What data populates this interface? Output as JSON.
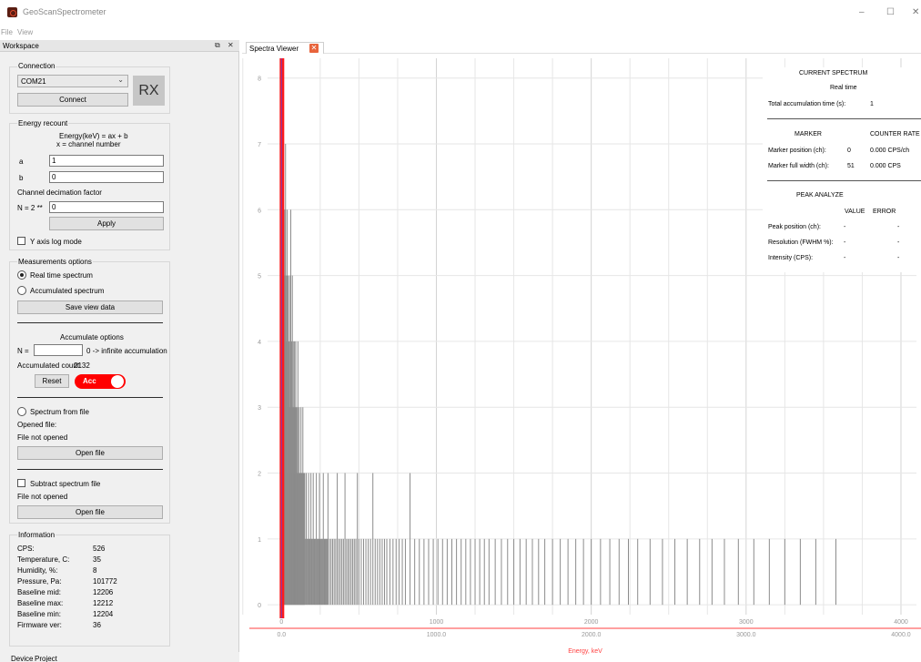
{
  "window": {
    "title": "GeoScanSpectrometer",
    "minimize": "–",
    "maximize": "☐",
    "close": "✕"
  },
  "menu": {
    "file": "File",
    "view": "View"
  },
  "workspace": {
    "title": "Workspace",
    "float_icon": "⧉",
    "close_icon": "✕"
  },
  "connection": {
    "title": "Connection",
    "port": "COM21",
    "connect_label": "Connect",
    "rx_label": "RX"
  },
  "energy": {
    "title": "Energy recount",
    "formula_line1": "Energy(keV) = ax + b",
    "formula_line2": "x = channel number",
    "a_label": "a",
    "a_value": "1",
    "b_label": "b",
    "b_value": "0",
    "decimation_label": "Channel decimation factor",
    "n_label": "N = 2 **",
    "n_value": "0",
    "apply_label": "Apply",
    "log_mode_label": "Y axis log mode"
  },
  "measurements": {
    "title": "Measurements options",
    "realtime_label": "Real time spectrum",
    "accumulated_label": "Accumulated spectrum",
    "save_label": "Save view data",
    "accum_title": "Accumulate options",
    "n_label": "N =",
    "n_value": "",
    "n_hint": "0 -> infinite accumulation",
    "accum_count_label": "Accumulated count:",
    "accum_count_value": "2132",
    "reset_label": "Reset",
    "acc_toggle_label": "Acc",
    "from_file_label": "Spectrum from file",
    "opened_file_label": "Opened file:",
    "file_status": "File not opened",
    "open_file_label": "Open file",
    "subtract_label": "Subtract spectrum file",
    "subtract_status": "File not opened",
    "subtract_open_label": "Open file"
  },
  "information": {
    "title": "Information",
    "rows": [
      {
        "label": "CPS:",
        "value": "526"
      },
      {
        "label": "Temperature, C:",
        "value": "35"
      },
      {
        "label": "Humidity, %:",
        "value": "8"
      },
      {
        "label": "Pressure, Pa:",
        "value": "101772"
      },
      {
        "label": "Baseline mid:",
        "value": "12206"
      },
      {
        "label": "Baseline max:",
        "value": "12212"
      },
      {
        "label": "Baseline min:",
        "value": "12204"
      },
      {
        "label": "Firmware ver:",
        "value": "36"
      }
    ]
  },
  "bottom_tabs": {
    "device": "Device",
    "project": "Project"
  },
  "viewer_tab": {
    "label": "Spectra Viewer",
    "close": "✕"
  },
  "current": {
    "title": "CURRENT SPECTRUM",
    "mode": "Real time",
    "total_label": "Total accumulation time (s):",
    "total_value": "1",
    "marker_header": "MARKER",
    "counter_header": "COUNTER RATE",
    "marker_pos_label": "Marker position (ch):",
    "marker_pos_value": "0",
    "marker_pos_rate": "0.000 CPS/ch",
    "marker_width_label": "Marker full width (ch):",
    "marker_width_value": "51",
    "marker_width_rate": "0.000 CPS",
    "peak_title": "PEAK ANALYZE",
    "value_header": "VALUE",
    "error_header": "ERROR",
    "peak_rows": [
      {
        "label": "Peak position (ch):",
        "value": "-",
        "error": "-"
      },
      {
        "label": "Resolution (FWHM %):",
        "value": "-",
        "error": "-"
      },
      {
        "label": "Intensity (CPS):",
        "value": "-",
        "error": "-"
      }
    ]
  },
  "chart_data": {
    "type": "bar",
    "xlabel": "Energy, keV",
    "ylabel": "",
    "xlim": [
      -90,
      4100
    ],
    "ylim": [
      -0.15,
      8.3
    ],
    "x_ticks_top": [
      "0",
      "1000",
      "2000",
      "3000",
      "4000"
    ],
    "x_ticks_bottom": [
      "0.0",
      "1000.0",
      "2000.0",
      "3000.0",
      "4000.0"
    ],
    "y_ticks": [
      "0",
      "1",
      "2",
      "3",
      "4",
      "5",
      "6",
      "7",
      "8"
    ],
    "grid": true,
    "marker_channel": 0,
    "colors": {
      "bars": "#8c8c8c",
      "marker": "#ff1a1a",
      "marker_inner": "#7b3db8",
      "axis": "#ff4040",
      "grid": "#e6e6e6"
    },
    "channels": [
      2,
      4,
      6,
      8,
      10,
      12,
      14,
      16,
      18,
      20,
      22,
      24,
      26,
      28,
      30,
      32,
      34,
      36,
      38,
      40,
      42,
      44,
      46,
      48,
      50,
      52,
      54,
      56,
      58,
      60,
      62,
      64,
      66,
      68,
      70,
      72,
      74,
      76,
      78,
      80,
      82,
      84,
      86,
      88,
      90,
      92,
      94,
      96,
      98,
      100,
      102,
      104,
      106,
      108,
      110,
      112,
      114,
      116,
      118,
      120,
      122,
      124,
      126,
      128,
      130,
      132,
      134,
      136,
      138,
      140,
      142,
      144,
      146,
      148,
      150,
      155,
      160,
      165,
      170,
      175,
      180,
      185,
      190,
      195,
      200,
      205,
      210,
      215,
      220,
      225,
      230,
      235,
      240,
      245,
      250,
      255,
      260,
      265,
      270,
      275,
      280,
      285,
      290,
      295,
      300,
      310,
      320,
      330,
      340,
      350,
      360,
      370,
      380,
      390,
      400,
      410,
      420,
      430,
      440,
      450,
      460,
      470,
      480,
      490,
      500,
      515,
      530,
      545,
      560,
      575,
      590,
      605,
      620,
      635,
      650,
      665,
      680,
      700,
      720,
      740,
      760,
      780,
      800,
      830,
      860,
      890,
      920,
      950,
      980,
      1010,
      1040,
      1070,
      1100,
      1130,
      1160,
      1190,
      1220,
      1250,
      1280,
      1310,
      1340,
      1380,
      1420,
      1460,
      1500,
      1540,
      1580,
      1620,
      1660,
      1700,
      1750,
      1800,
      1850,
      1900,
      1950,
      2000,
      2060,
      2120,
      2180,
      2240,
      2300,
      2380,
      2460,
      2540,
      2620,
      2700,
      2780,
      2860,
      2950,
      3050,
      3150,
      3250,
      3350,
      3450,
      3580
    ],
    "values": [
      2,
      3,
      6,
      5,
      8,
      4,
      6,
      3,
      5,
      4,
      6,
      2,
      7,
      3,
      5,
      4,
      3,
      6,
      2,
      4,
      5,
      3,
      2,
      4,
      3,
      5,
      2,
      3,
      4,
      6,
      2,
      3,
      4,
      2,
      5,
      3,
      2,
      4,
      3,
      2,
      3,
      4,
      2,
      3,
      2,
      4,
      2,
      3,
      2,
      2,
      3,
      2,
      4,
      2,
      1,
      2,
      3,
      2,
      1,
      2,
      2,
      1,
      3,
      2,
      1,
      2,
      1,
      2,
      3,
      1,
      2,
      1,
      2,
      1,
      2,
      1,
      2,
      1,
      1,
      2,
      1,
      1,
      2,
      1,
      1,
      2,
      1,
      1,
      1,
      2,
      1,
      1,
      1,
      2,
      1,
      1,
      1,
      1,
      2,
      1,
      1,
      1,
      1,
      1,
      2,
      1,
      1,
      1,
      1,
      1,
      2,
      1,
      1,
      1,
      1,
      2,
      1,
      1,
      1,
      1,
      1,
      1,
      1,
      2,
      1,
      1,
      1,
      1,
      1,
      1,
      2,
      1,
      1,
      1,
      1,
      1,
      1,
      1,
      1,
      1,
      1,
      1,
      1,
      2,
      1,
      1,
      1,
      1,
      1,
      1,
      1,
      1,
      1,
      1,
      1,
      1,
      1,
      1,
      1,
      1,
      1,
      1,
      1,
      1,
      1,
      1,
      1,
      1,
      1,
      1,
      1,
      1,
      1,
      1,
      1,
      1,
      1,
      1,
      1,
      1,
      1,
      1,
      1,
      1,
      1,
      1,
      1,
      1,
      1,
      1,
      1,
      1,
      1,
      1,
      1,
      1,
      1,
      1,
      1
    ]
  }
}
